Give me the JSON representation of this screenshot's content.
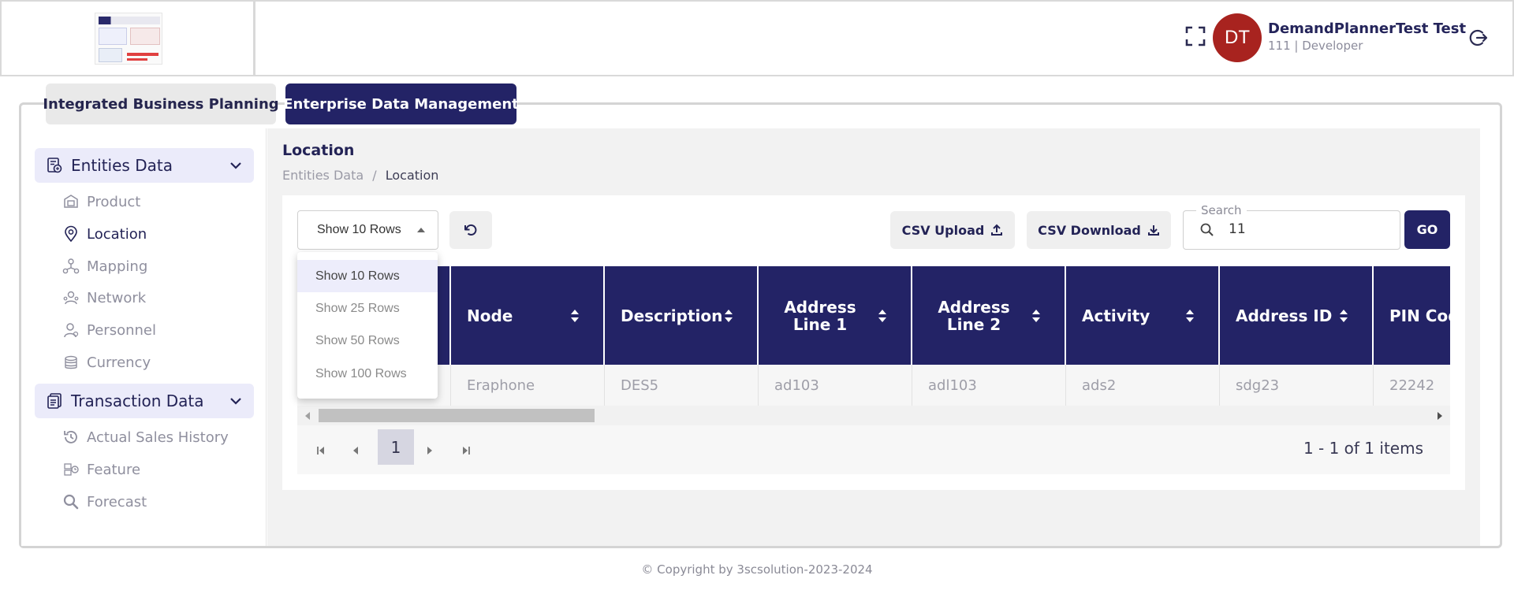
{
  "header": {
    "avatar_initials": "DT",
    "user_name": "DemandPlannerTest Test",
    "user_role": "111 | Developer",
    "avatar_color": "#a8231f"
  },
  "tabs": [
    {
      "label": "Integrated Business Planning",
      "active": false
    },
    {
      "label": "Enterprise Data Management",
      "active": true
    }
  ],
  "sidebar": {
    "groups": [
      {
        "label": "Entities Data",
        "icon": "entities-icon",
        "items": [
          {
            "label": "Product",
            "icon": "product-icon",
            "active": false
          },
          {
            "label": "Location",
            "icon": "location-pin-icon",
            "active": true
          },
          {
            "label": "Mapping",
            "icon": "mapping-icon",
            "active": false
          },
          {
            "label": "Network",
            "icon": "network-icon",
            "active": false
          },
          {
            "label": "Personnel",
            "icon": "personnel-icon",
            "active": false
          },
          {
            "label": "Currency",
            "icon": "currency-icon",
            "active": false
          }
        ]
      },
      {
        "label": "Transaction Data",
        "icon": "transaction-icon",
        "items": [
          {
            "label": "Actual Sales History",
            "icon": "history-icon",
            "active": false
          },
          {
            "label": "Feature",
            "icon": "feature-icon",
            "active": false
          },
          {
            "label": "Forecast",
            "icon": "forecast-search-icon",
            "active": false
          }
        ]
      }
    ]
  },
  "page": {
    "title": "Location",
    "breadcrumb": [
      "Entities Data",
      "Location"
    ],
    "breadcrumb_sep": "/"
  },
  "toolbar": {
    "rows_selected": "Show 10 Rows",
    "rows_options": [
      "Show 10 Rows",
      "Show 25 Rows",
      "Show 50 Rows",
      "Show 100 Rows"
    ],
    "csv_upload": "CSV Upload",
    "csv_download": "CSV Download",
    "search_label": "Search",
    "search_value": "11",
    "go": "GO"
  },
  "table": {
    "columns": [
      "",
      "Node",
      "Description",
      "Address Line 1",
      "Address Line 2",
      "Activity",
      "Address ID",
      "PIN Code"
    ],
    "rows": [
      [
        "",
        "Eraphone",
        "DES5",
        "ad103",
        "adl103",
        "ads2",
        "sdg23",
        "22242"
      ]
    ]
  },
  "pager": {
    "current_page": "1",
    "info": "1 - 1 of 1 items"
  },
  "footer": {
    "copyright": "© Copyright by 3scsolution-2023-2024"
  },
  "colors": {
    "primary": "#232366",
    "accent_light": "#ebebfa"
  }
}
